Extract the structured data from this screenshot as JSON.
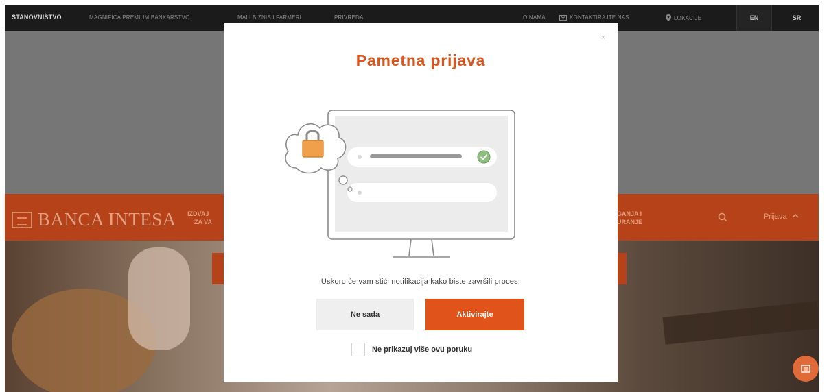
{
  "topbar": {
    "links": [
      {
        "label": "STANOVNIŠTVO",
        "active": true
      },
      {
        "label": "MAGNIFICA PREMIUM BANKARSTVO"
      },
      {
        "label": "MALI BIZNIS I FARMERI"
      },
      {
        "label": "PRIVREDA"
      },
      {
        "label": "O NAMA"
      },
      {
        "label": "KONTAKTIRAJTE NAS"
      },
      {
        "label": "LOKACIJE"
      }
    ],
    "languages": [
      "EN",
      "SR"
    ]
  },
  "nav": {
    "logo_text": "BANCA INTESA",
    "left_fragment_line1": "IZDVAJ",
    "left_fragment_line2": "ZA VA",
    "right_fragment_line1": "GANJA I",
    "right_fragment_line2": "URANJE",
    "prijava_label": "Prijava"
  },
  "modal": {
    "close_label": "×",
    "title": "Pametna prijava",
    "message": "Uskoro će vam stići notifikacija kako biste završili proces.",
    "secondary_button": "Ne sada",
    "primary_button": "Aktivirajte",
    "checkbox_label": "Ne prikazuj više ovu poruku",
    "checkbox_checked": false
  },
  "colors": {
    "brand_orange": "#e0541c",
    "title_orange": "#d8561d"
  },
  "icons": [
    "envelope-icon",
    "location-pin-icon",
    "search-icon",
    "chevron-up-icon",
    "padlock-icon",
    "checkmark-icon",
    "user-icon",
    "chat-icon"
  ]
}
